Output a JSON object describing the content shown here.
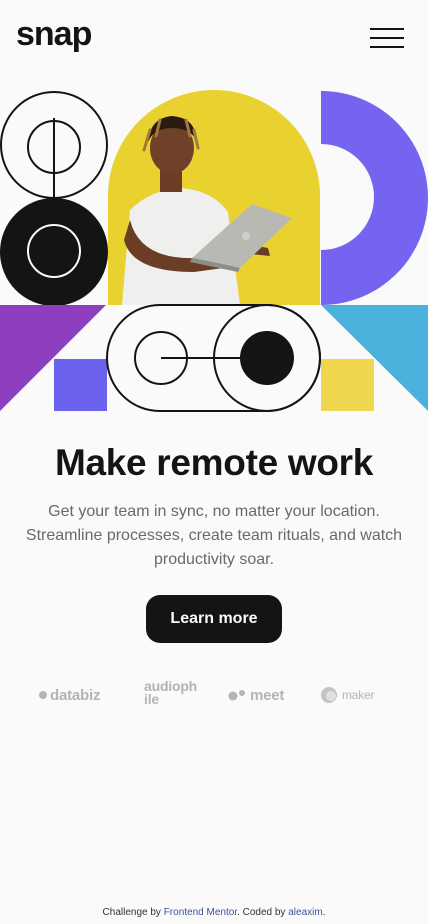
{
  "header": {
    "logo": "snap",
    "menu_icon": "hamburger-menu-icon"
  },
  "hero": {
    "illustration": "person-with-laptop-geometric-collage",
    "colors": {
      "yellow": "#e9d230",
      "purple": "#7464ef",
      "violet": "#8e3fbf",
      "blue": "#4ab0dc",
      "soft_yellow": "#f0d64e",
      "dark": "#141414"
    }
  },
  "main": {
    "headline": "Make remote work",
    "description": "Get your team in sync, no matter your location. Streamline processes, create team rituals, and watch productivity soar.",
    "cta_label": "Learn more"
  },
  "clients": [
    {
      "name": "databiz",
      "icon": "databiz-logo"
    },
    {
      "name": "audiophile",
      "icon": "audiophile-logo"
    },
    {
      "name": "meet",
      "icon": "meet-logo"
    },
    {
      "name": "maker",
      "icon": "maker-logo"
    }
  ],
  "footer": {
    "challenge_prefix": "Challenge by",
    "challenge_link": "Frontend Mentor",
    "coded_prefix": ". Coded by",
    "coded_link": "aleaxim",
    "suffix": "."
  }
}
